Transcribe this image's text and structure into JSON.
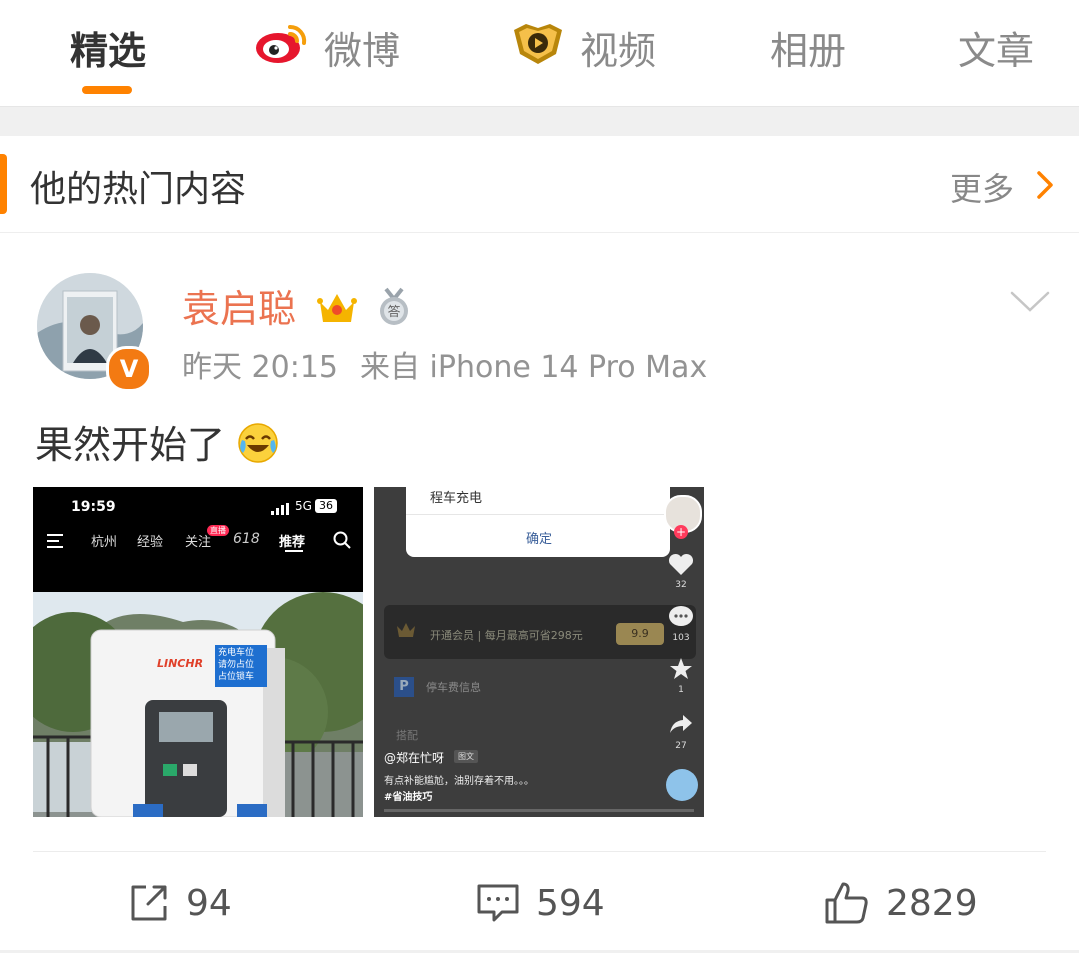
{
  "colors": {
    "accent": "#ff8200",
    "username": "#eb7350",
    "vip_badge": "#f37a12"
  },
  "tabs": [
    {
      "label": "精选",
      "active": true
    },
    {
      "label": "微博",
      "icon": "weibo-logo-icon"
    },
    {
      "label": "视频",
      "icon": "video-badge-icon"
    },
    {
      "label": "相册"
    },
    {
      "label": "文章"
    }
  ],
  "section": {
    "title": "他的热门内容",
    "more": "更多"
  },
  "post": {
    "author": "袁启聪",
    "badges": [
      "crown-badge-icon",
      "answer-medal-icon"
    ],
    "time": "昨天 20:15",
    "source": "来自 iPhone 14 Pro Max",
    "text": "果然开始了",
    "emoji": "laugh-cry-emoji-icon",
    "image1": {
      "time": "19:59",
      "signal": "5G",
      "battery": "36",
      "nav": [
        "杭州",
        "经验",
        "关注",
        "618",
        "推荐"
      ],
      "live_badge": "直播",
      "sign_brand": "LINCHR",
      "sign_text": [
        "充电车位",
        "请勿占位",
        "占位锁车"
      ]
    },
    "image2": {
      "dialog_text": "程车充电",
      "dialog_button": "确定",
      "banner": "开通会员 | 每月最高可省298元",
      "banner_price": "9.9",
      "parking": "停车费信息",
      "section_label": "搭配",
      "author": "@郑在忙呀",
      "tag": "图文",
      "caption": "有点补能尴尬，油别存着不用。。。",
      "hashtag": "#省油技巧",
      "likes": "32",
      "comments": "103",
      "favorites": "1",
      "shares": "27"
    }
  },
  "actions": {
    "reposts": "94",
    "comments": "594",
    "likes": "2829"
  }
}
